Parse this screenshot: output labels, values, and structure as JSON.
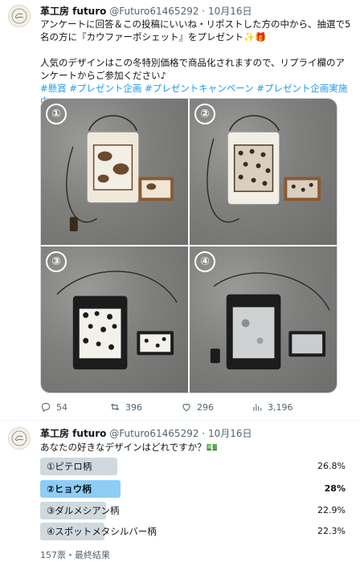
{
  "tweet1": {
    "name": "革工房 futuro",
    "handle": "@Futuro61465292",
    "sep": " · ",
    "date": "10月16日",
    "line1": "アンケートに回答＆この投稿にいいね・リポストした方の中から、抽選で5名の方に『カウファーポシェット』をプレゼント✨🎁",
    "line2": "人気のデザインはこの冬特別価格で商品化されますので、リプライ欄のアンケートからご参加ください♪",
    "hashtags": "#懸賞 #プレゼント企画 #プレゼントキャンペーン #プレゼント企画実施中",
    "photos": [
      "①",
      "②",
      "③",
      "④"
    ],
    "stats": {
      "replies": "54",
      "reposts": "396",
      "likes": "296",
      "views": "3,196"
    }
  },
  "tweet2": {
    "name": "革工房 futuro",
    "handle": "@Futuro61465292",
    "sep": " · ",
    "date": "10月16日",
    "question": "あなたの好きなデザインはどれですか？",
    "emoji": "💵",
    "poll": [
      {
        "label": "①ピテロ柄",
        "percent": 26.8,
        "percent_text": "26.8%",
        "winner": false
      },
      {
        "label": "②ヒョウ柄",
        "percent": 28,
        "percent_text": "28%",
        "winner": true
      },
      {
        "label": "③ダルメシアン柄",
        "percent": 22.9,
        "percent_text": "22.9%",
        "winner": false
      },
      {
        "label": "④スポットメタシルバー柄",
        "percent": 22.3,
        "percent_text": "22.3%",
        "winner": false
      }
    ],
    "summary": "157票・最終結果"
  },
  "colors": {
    "link": "#1d9bf0",
    "poll_bar": "#cfd9de",
    "poll_winner": "#8ecdf8",
    "muted": "#536471"
  }
}
